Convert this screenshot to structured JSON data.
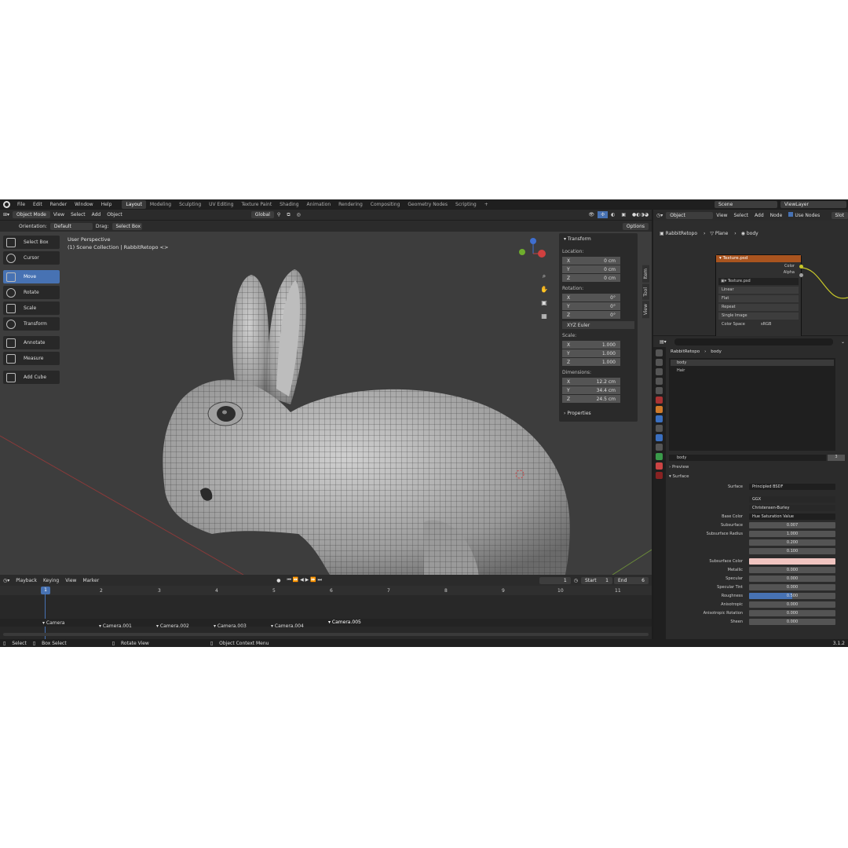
{
  "menu": {
    "items": [
      "File",
      "Edit",
      "Render",
      "Window",
      "Help"
    ],
    "workspaces": [
      "Layout",
      "Modeling",
      "Sculpting",
      "UV Editing",
      "Texture Paint",
      "Shading",
      "Animation",
      "Rendering",
      "Compositing",
      "Geometry Nodes",
      "Scripting"
    ],
    "add": "+",
    "scene": "Scene",
    "view_layer": "ViewLayer"
  },
  "viewport_header": {
    "mode": "Object Mode",
    "view": "View",
    "select": "Select",
    "add": "Add",
    "object": "Object",
    "transform_orientation": "Global",
    "orientation_label": "Orientation:",
    "orientation_value": "Default",
    "drag_label": "Drag:",
    "drag_value": "Select Box",
    "options": "Options"
  },
  "toolbar": {
    "items": [
      "Select Box",
      "Cursor",
      "Move",
      "Rotate",
      "Scale",
      "Transform",
      "Annotate",
      "Measure",
      "Add Cube"
    ],
    "active": "Move"
  },
  "overlay": {
    "line1": "User Perspective",
    "line2": "(1) Scene Collection | RabbitRetopo <>"
  },
  "npanel": {
    "title": "Transform",
    "location_label": "Location:",
    "location": [
      {
        "k": "X",
        "v": "0 cm"
      },
      {
        "k": "Y",
        "v": "0 cm"
      },
      {
        "k": "Z",
        "v": "0 cm"
      }
    ],
    "rotation_label": "Rotation:",
    "rotation": [
      {
        "k": "X",
        "v": "0°"
      },
      {
        "k": "Y",
        "v": "0°"
      },
      {
        "k": "Z",
        "v": "0°"
      }
    ],
    "rotation_mode": "XYZ Euler",
    "scale_label": "Scale:",
    "scale": [
      {
        "k": "X",
        "v": "1.000"
      },
      {
        "k": "Y",
        "v": "1.000"
      },
      {
        "k": "Z",
        "v": "1.000"
      }
    ],
    "dimensions_label": "Dimensions:",
    "dimensions": [
      {
        "k": "X",
        "v": "12.2 cm"
      },
      {
        "k": "Y",
        "v": "34.4 cm"
      },
      {
        "k": "Z",
        "v": "24.5 cm"
      }
    ],
    "properties": "Properties",
    "tabs": [
      "Item",
      "Tool",
      "View"
    ]
  },
  "timeline": {
    "playback": "Playback",
    "keying": "Keying",
    "view": "View",
    "marker": "Marker",
    "current_frame": "1",
    "start_label": "Start",
    "start": "1",
    "end_label": "End",
    "end": "6",
    "ruler": [
      "1",
      "2",
      "3",
      "4",
      "5",
      "6",
      "7",
      "8",
      "9",
      "10",
      "11"
    ],
    "markers": [
      "Camera",
      "Camera.001",
      "Camera.002",
      "Camera.003",
      "Camera.004",
      "Camera.005"
    ]
  },
  "status": {
    "select": "Select",
    "box_select": "Box Select",
    "rotate_view": "Rotate View",
    "context_menu": "Object Context Menu",
    "version": "3.1.2"
  },
  "node_editor": {
    "object": "Object",
    "view": "View",
    "select": "Select",
    "add": "Add",
    "node": "Node",
    "use_nodes": "Use Nodes",
    "slot": "Slot",
    "breadcrumb": [
      "RabbitRetopo",
      "Plane",
      "body"
    ],
    "node_title": "Texture.psd",
    "outputs": [
      "Color",
      "Alpha"
    ],
    "image": "Texture.psd",
    "interpolation": "Linear",
    "projection": "Flat",
    "extension": "Repeat",
    "source": "Single Image",
    "color_space_label": "Color Space",
    "color_space": "sRGB"
  },
  "properties": {
    "breadcrumb": [
      "RabbitRetopo",
      "body"
    ],
    "slots": [
      "body",
      "Hair"
    ],
    "material": "body",
    "users": "3",
    "preview": "Preview",
    "surface_section": "Surface",
    "surface_label": "Surface",
    "surface": "Principled BSDF",
    "distribution": "GGX",
    "subsurface_method": "Christensen-Burley",
    "base_color_label": "Base Color",
    "base_color": "Hue Saturation Value",
    "fields": [
      {
        "label": "Subsurface",
        "value": "0.007"
      },
      {
        "label": "Subsurface Radius",
        "value": "1.000"
      }
    ],
    "radius_extra": [
      "0.200",
      "0.100"
    ],
    "subsurface_color_label": "Subsurface Color",
    "subsurface_color": "#f0c4c0",
    "fields2": [
      {
        "label": "Metallic",
        "value": "0.000"
      },
      {
        "label": "Specular",
        "value": "0.000"
      },
      {
        "label": "Specular Tint",
        "value": "0.000"
      },
      {
        "label": "Roughness",
        "value": "0.500"
      },
      {
        "label": "Anisotropic",
        "value": "0.000"
      },
      {
        "label": "Anisotropic Rotation",
        "value": "0.000"
      },
      {
        "label": "Sheen",
        "value": "0.000"
      }
    ],
    "roughness_fill": 0.5
  },
  "colors": {
    "accent": "#4772b3",
    "node_header": "#a9541f",
    "link": "#c7c729"
  }
}
